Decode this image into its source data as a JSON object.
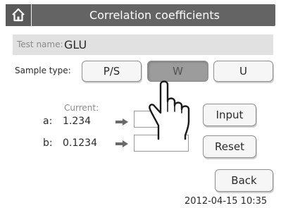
{
  "header": {
    "title": "Correlation coefficients",
    "home_icon": "home-icon"
  },
  "test": {
    "label": "Test name:",
    "value": "GLU"
  },
  "sample_type": {
    "label": "Sample type:",
    "options": [
      "P/S",
      "W",
      "U"
    ],
    "selected": "W"
  },
  "coefficients": {
    "current_label": "Current:",
    "a": {
      "name": "a:",
      "current": "1.234",
      "new_value": ""
    },
    "b": {
      "name": "b:",
      "current": "0.1234",
      "new_value": ""
    }
  },
  "buttons": {
    "input": "Input",
    "reset": "Reset",
    "back": "Back"
  },
  "status": {
    "datetime": "2012-04-15 10:35"
  },
  "overlay": {
    "pointer_icon": "hand-pointer-icon"
  },
  "colors": {
    "header_bg": "#646464",
    "selected_segment": "#9c9c9c",
    "field_bar": "#e1e1e1"
  }
}
